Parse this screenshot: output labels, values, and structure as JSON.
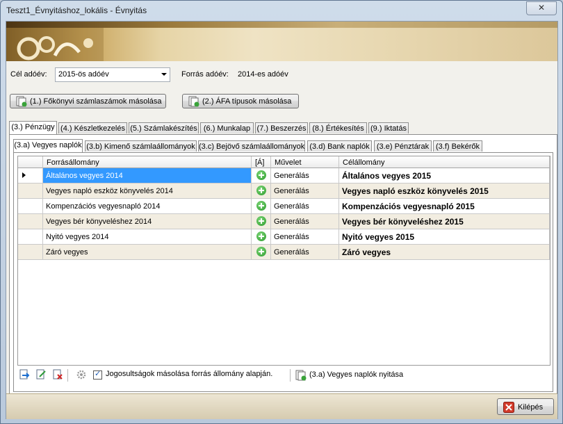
{
  "window": {
    "title": "Teszt1_Évnyitáshoz_lokális - Évnyitás",
    "close_label": "✕"
  },
  "form": {
    "target_year_label": "Cél adóév:",
    "target_year_value": "2015-ös adóév",
    "source_year_label": "Forrás adóév:",
    "source_year_value": "2014-es adóév",
    "copy_accounts_button": "(1.) Főkönyvi számlaszámok másolása",
    "copy_vat_button": "(2.) ÁFA típusok másolása"
  },
  "main_tabs": [
    {
      "label": "(3.) Pénzügy"
    },
    {
      "label": "(4.) Készletkezelés"
    },
    {
      "label": "(5.) Számlakészítés"
    },
    {
      "label": "(6.) Munkalap"
    },
    {
      "label": "(7.) Beszerzés"
    },
    {
      "label": "(8.) Értékesítés"
    },
    {
      "label": "(9.) Iktatás"
    }
  ],
  "sub_tabs": [
    {
      "label": "(3.a) Vegyes naplók"
    },
    {
      "label": "(3.b) Kimenő számlaállományok"
    },
    {
      "label": "(3.c) Bejövő számlaállományok"
    },
    {
      "label": "(3.d) Bank naplók"
    },
    {
      "label": "(3.e) Pénztárak"
    },
    {
      "label": "(3.f) Bekérők"
    }
  ],
  "grid": {
    "headers": [
      "Forrásállomány",
      "[Á]",
      "Művelet",
      "Célállomány"
    ],
    "rows": [
      {
        "source": "Általános vegyes 2014",
        "operation": "Generálás",
        "target": "Általános vegyes 2015"
      },
      {
        "source": "Vegyes napló eszköz könyvelés 2014",
        "operation": "Generálás",
        "target": "Vegyes napló eszköz könyvelés 2015"
      },
      {
        "source": "Kompenzációs vegyesnapló 2014",
        "operation": "Generálás",
        "target": "Kompenzációs vegyesnapló 2015"
      },
      {
        "source": "Vegyes bér könyveléshez 2014",
        "operation": "Generálás",
        "target": "Vegyes bér könyveléshez 2015"
      },
      {
        "source": "Nyitó vegyes 2014",
        "operation": "Generálás",
        "target": "Nyitó vegyes 2015"
      },
      {
        "source": "Záró vegyes",
        "operation": "Generálás",
        "target": "Záró vegyes"
      }
    ]
  },
  "toolbar": {
    "copy_permissions_label": "Jogosultságok másolása forrás állomány alapján.",
    "open_journals_button": "(3.a) Vegyes naplók nyitása"
  },
  "footer": {
    "exit_button": "Kilépés"
  }
}
